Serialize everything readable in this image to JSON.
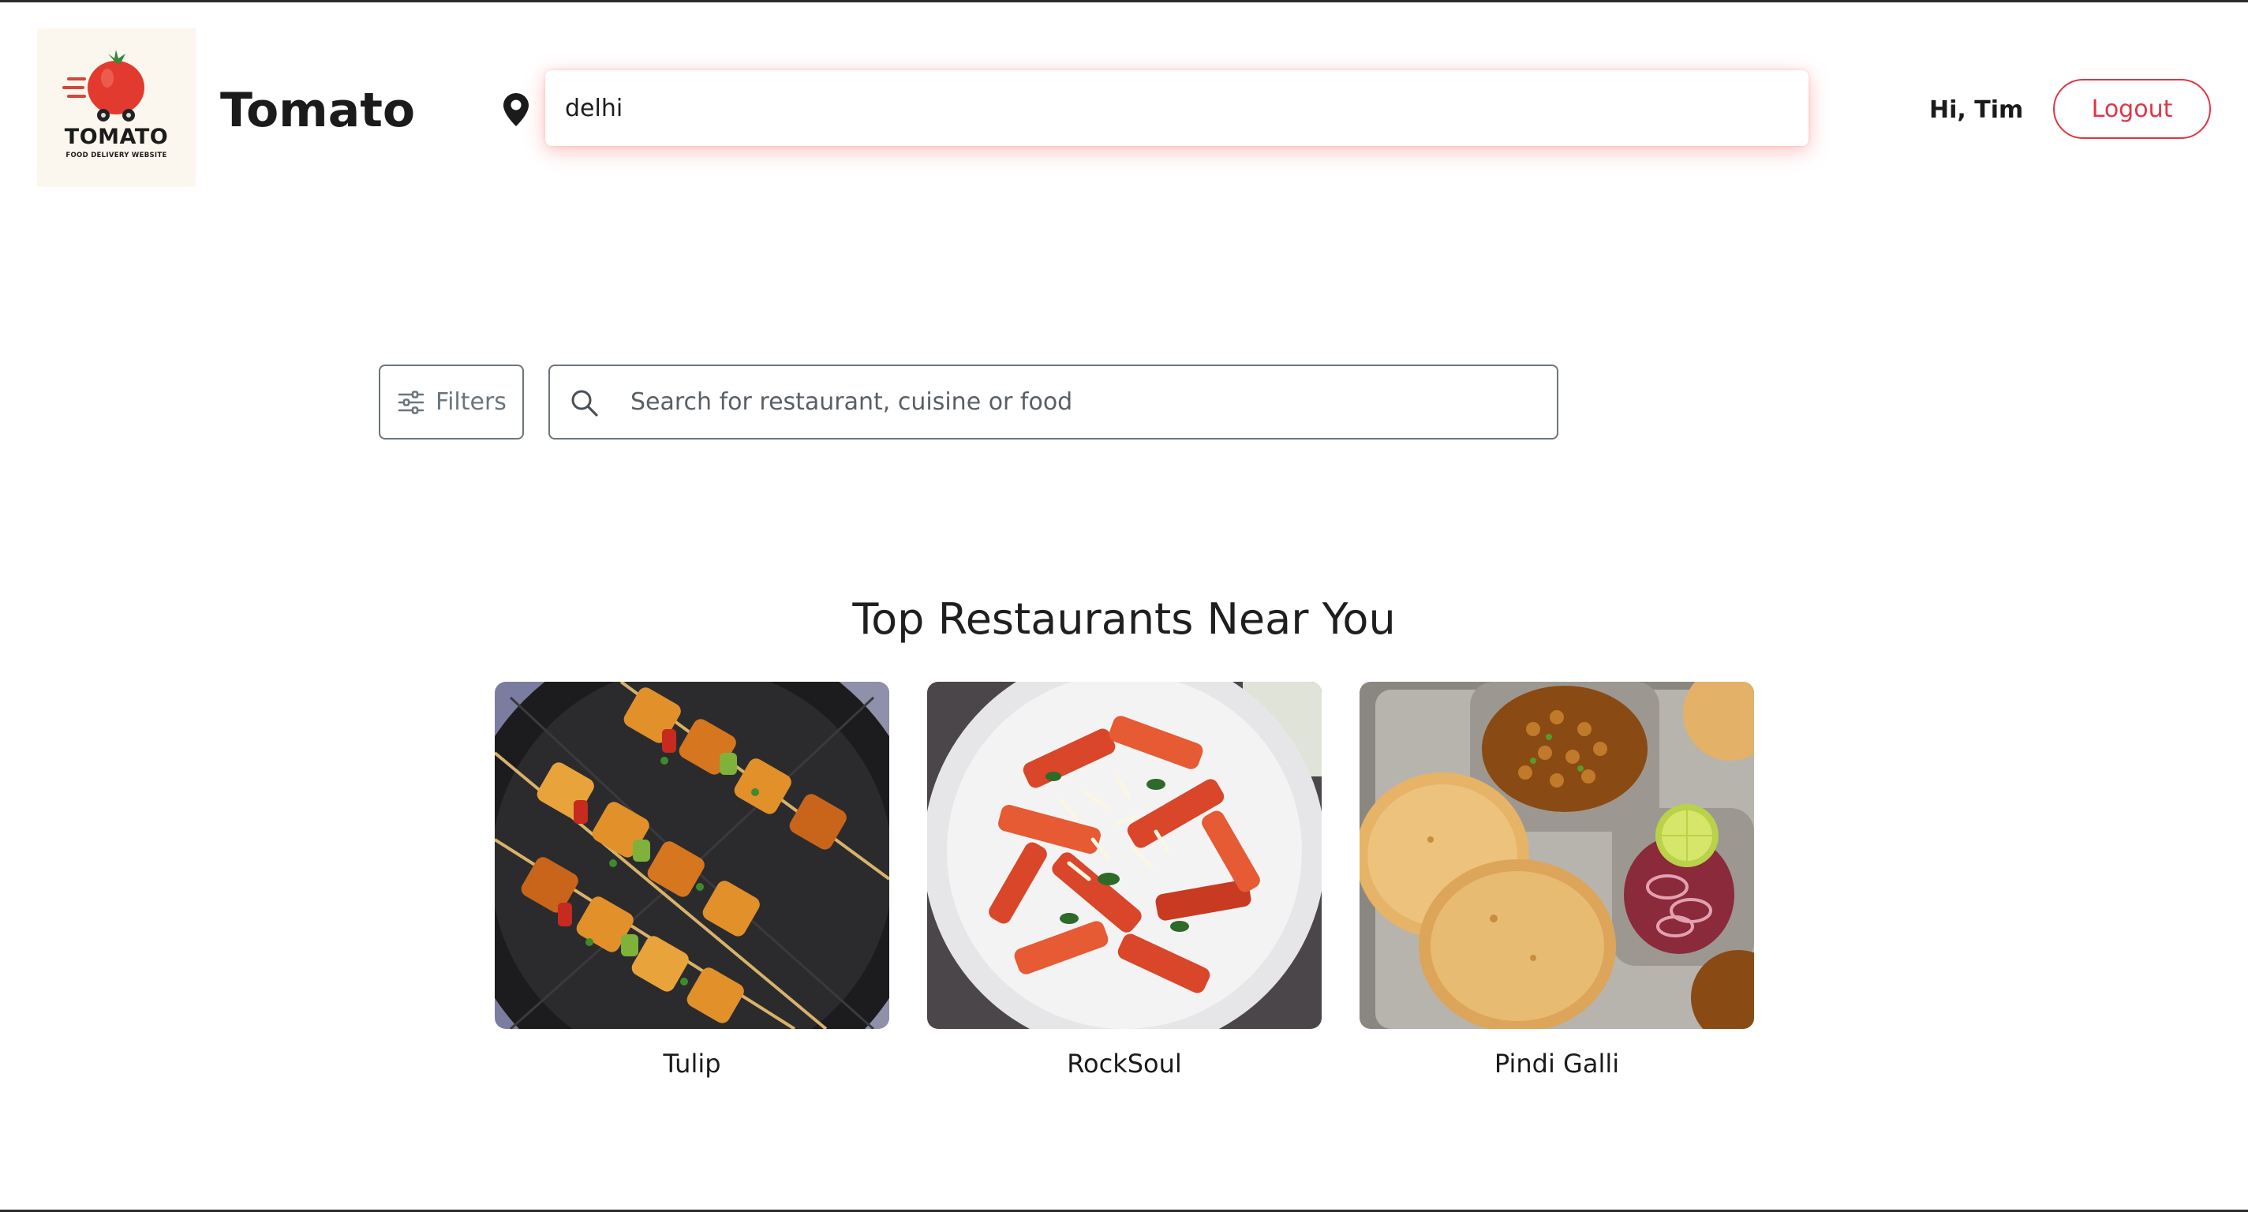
{
  "header": {
    "logo": {
      "wordmark": "TOMATO",
      "tagline": "FOOD DELIVERY WEBSITE",
      "icon": "tomato-delivery-logo"
    },
    "brand_name": "Tomato",
    "location": {
      "icon": "map-pin-icon",
      "value": "delhi"
    },
    "greeting": "Hi, Tim",
    "logout_label": "Logout"
  },
  "toolbar": {
    "filters_label": "Filters",
    "filters_icon": "sliders-icon",
    "search_icon": "search-icon",
    "search_placeholder": "Search for restaurant, cuisine or food"
  },
  "restaurants": {
    "title": "Top Restaurants Near You",
    "items": [
      {
        "name": "Tulip",
        "image": "paneer tikka skewers on a black plate"
      },
      {
        "name": "RockSoul",
        "image": "penne pasta in red sauce in a white bowl"
      },
      {
        "name": "Pindi Galli",
        "image": "chole bhature thali with onions and lime"
      }
    ]
  },
  "colors": {
    "accent": "#e03546",
    "text": "#1b1b1b",
    "muted": "#6c757d",
    "logo_bg": "#fcf7ee"
  }
}
